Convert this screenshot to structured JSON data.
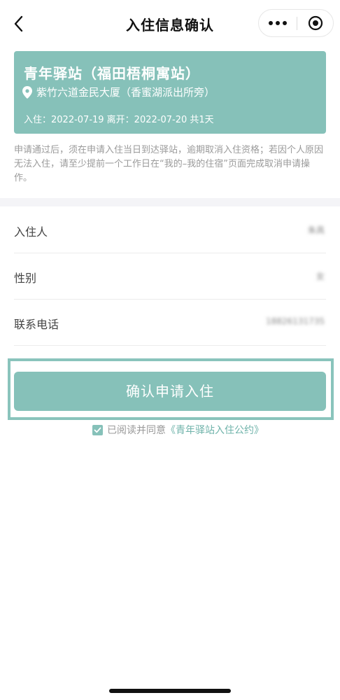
{
  "nav": {
    "title": "入住信息确认",
    "back_icon": "chevron-left-icon",
    "more_icon": "more-dots-icon",
    "close_icon": "target-close-icon"
  },
  "hostel": {
    "name": "青年驿站（福田梧桐寓站）",
    "address": "紫竹六道金民大厦（香蜜湖派出所旁）",
    "dates": "入住：2022-07-19 离开：2022-07-20 共1天",
    "location_icon": "location-pin-icon"
  },
  "notice": "申请通过后，须在申请入住当日到达驿站，逾期取消入住资格；若因个人原因无法入住，请至少提前一个工作日在“我的–我的住宿”页面完成取消申请操作。",
  "form": {
    "rows": [
      {
        "label": "入住人",
        "value": "朱具"
      },
      {
        "label": "性别",
        "value": "女"
      },
      {
        "label": "联系电话",
        "value": "18826131735"
      }
    ]
  },
  "confirm_button": "确认申请入住",
  "agreement": {
    "prefix": "已阅读并同意",
    "link": "《青年驿站入住公约》",
    "checked": true
  },
  "colors": {
    "accent": "#86c1b9",
    "link": "#6fb3aa",
    "notice_text": "#9a9a9a"
  }
}
